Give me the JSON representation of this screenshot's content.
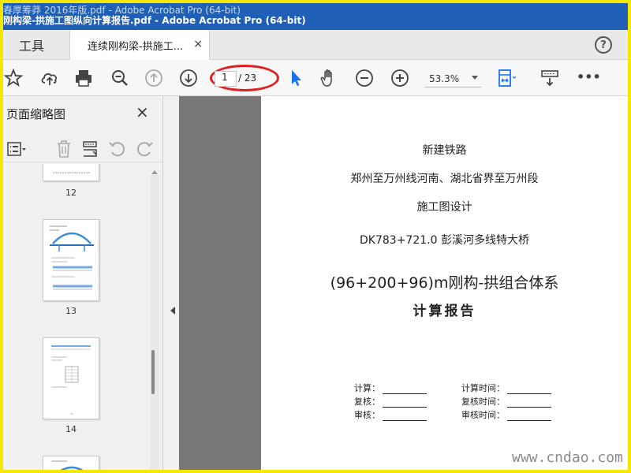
{
  "window": {
    "title_back": "春厚筹莽 2016年版.pdf - Adobe Acrobat Pro (64-bit)",
    "title_front": "刚构梁-拱施工图纵向计算报告.pdf - Adobe Acrobat Pro (64-bit)"
  },
  "tabs": {
    "tools_label": "工具",
    "document_label": "连续刚构梁-拱施工...",
    "close_glyph": "×",
    "help_glyph": "?"
  },
  "toolbar": {
    "page_current": "1",
    "page_total": "/ 23",
    "zoom": "53.3%",
    "icons": [
      "star-icon",
      "upload-icon",
      "print-icon",
      "zoom-out-search-icon",
      "page-up-icon",
      "page-down-icon",
      "select-pointer-icon",
      "hand-icon",
      "zoom-minus-icon",
      "zoom-plus-icon",
      "fit-page-icon",
      "scroll-mode-icon",
      "more-icon"
    ],
    "more_glyph": "•••"
  },
  "panel": {
    "title": "页面缩略图",
    "close_glyph": "×",
    "thumbnails": [
      {
        "label": "12"
      },
      {
        "label": "13"
      },
      {
        "label": "14"
      }
    ]
  },
  "document": {
    "line1": "新建铁路",
    "line2": "郑州至万州线河南、湖北省界至万州段",
    "line3": "施工图设计",
    "line4": "DK783+721.0  彭溪河多线特大桥",
    "line5": "(96+200+96)m刚构-拱组合体系",
    "line6": "计算报告",
    "sign": {
      "calc": "计算：",
      "review": "复核：",
      "check": "审核：",
      "calc_time": "计算时间：",
      "review_time": "复核时间：",
      "check_time": "审核时间："
    }
  },
  "watermark": "www.cndao.com",
  "colors": {
    "frame": "#f5e800",
    "titlebar": "#1f5fb5",
    "annotation": "#e02020",
    "accent_blue": "#1a73e8"
  }
}
